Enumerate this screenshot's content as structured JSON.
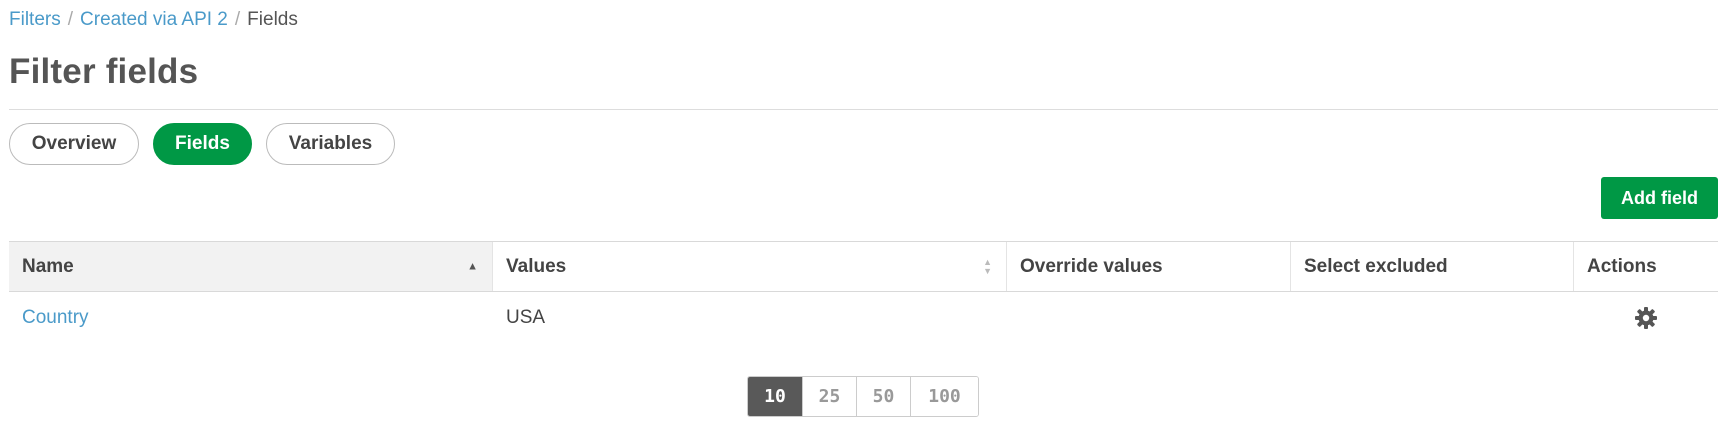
{
  "breadcrumb": {
    "items": [
      "Filters",
      "Created via API 2"
    ],
    "separator": "/",
    "current": "Fields"
  },
  "page": {
    "title": "Filter fields"
  },
  "tabs": [
    {
      "label": "Overview",
      "active": false
    },
    {
      "label": "Fields",
      "active": true
    },
    {
      "label": "Variables",
      "active": false
    }
  ],
  "toolbar": {
    "add_label": "Add field"
  },
  "table": {
    "columns": [
      "Name",
      "Values",
      "Override values",
      "Select excluded",
      "Actions"
    ],
    "sort": {
      "column": "Name",
      "direction": "asc"
    },
    "rows": [
      {
        "name": "Country",
        "values": "USA",
        "override_values": "",
        "select_excluded": "",
        "action_icon": "gear-icon"
      }
    ]
  },
  "pagination": {
    "sizes": [
      "10",
      "25",
      "50",
      "100"
    ],
    "selected": "10"
  },
  "colors": {
    "accent_green": "#009845",
    "link_blue": "#4a9ac9",
    "text": "#444444",
    "pager_active": "#595959"
  }
}
